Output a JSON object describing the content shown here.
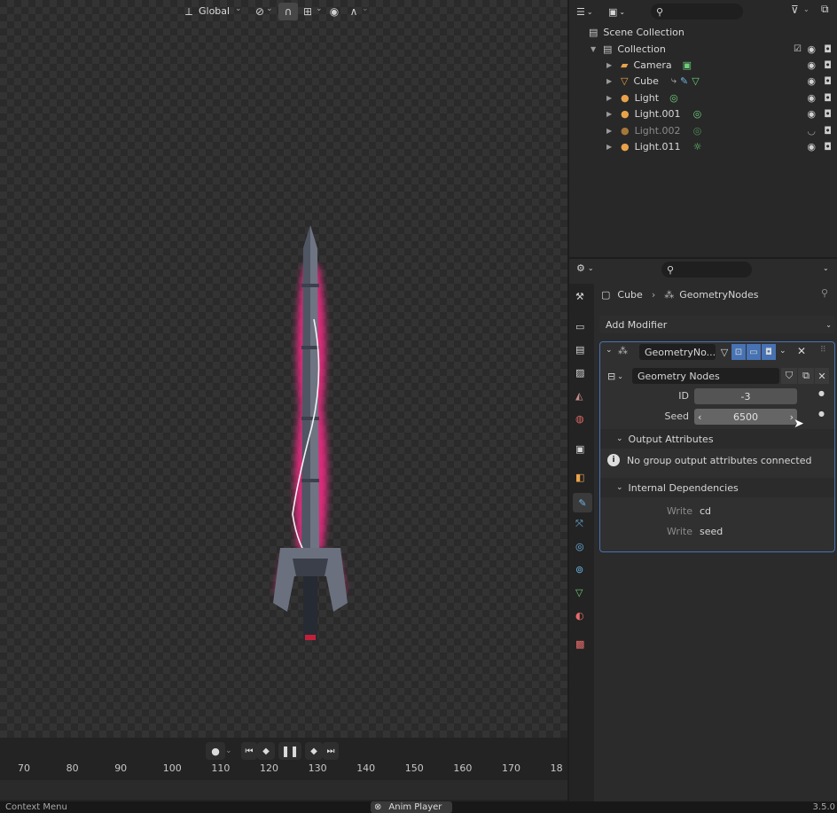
{
  "viewport": {
    "transform_orientation": "Global",
    "header_icons": [
      "axes-icon",
      "link-icon",
      "magnet-icon",
      "snap-grid-icon",
      "proportional-edit-icon",
      "falloff-curve-icon"
    ]
  },
  "outliner": {
    "search_placeholder": "",
    "root_label": "Scene Collection",
    "collection_label": "Collection",
    "items": [
      {
        "label": "Camera",
        "type": "camera"
      },
      {
        "label": "Cube",
        "type": "mesh"
      },
      {
        "label": "Light",
        "type": "light"
      },
      {
        "label": "Light.001",
        "type": "light"
      },
      {
        "label": "Light.002",
        "type": "light"
      },
      {
        "label": "Light.011",
        "type": "light"
      }
    ]
  },
  "properties": {
    "breadcrumb_object": "Cube",
    "breadcrumb_modifier": "GeometryNodes",
    "add_modifier_label": "Add Modifier",
    "modifier_name": "GeometryNo...",
    "node_group_name": "Geometry Nodes",
    "id_label": "ID",
    "id_value": "-3",
    "seed_label": "Seed",
    "seed_value": "6500",
    "output_attributes_label": "Output Attributes",
    "output_info": "No group output attributes connected",
    "internal_deps_label": "Internal Dependencies",
    "deps": [
      {
        "mode": "Write",
        "name": "cd"
      },
      {
        "mode": "Write",
        "name": "seed"
      }
    ]
  },
  "timeline": {
    "frames": [
      "70",
      "80",
      "90",
      "100",
      "110",
      "120",
      "130",
      "140",
      "150",
      "160",
      "170",
      "18"
    ]
  },
  "status": {
    "left_text": "Context Menu",
    "center_text": "Anim Player",
    "version": "3.5.0"
  },
  "colors": {
    "accent_blue": "#4772b3",
    "glow_pink": "#ff2a8a",
    "panel_bg": "#2b2b2b"
  }
}
